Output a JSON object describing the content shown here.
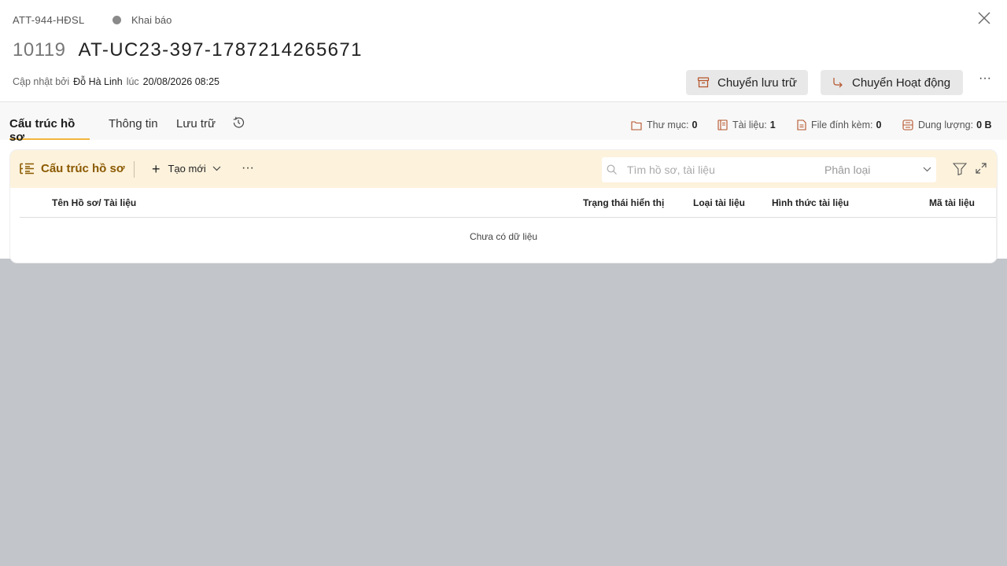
{
  "header": {
    "code": "ATT-944-HĐSL",
    "status": "Khai báo",
    "title_id": "10119",
    "title_name": "AT-UC23-397-1787214265671",
    "updated_prefix": "Cập nhật bởi",
    "updated_by": "Đỗ Hà Linh",
    "updated_at_word": "lúc",
    "updated_time": "20/08/2026 08:25",
    "btn_archive": "Chuyển lưu trữ",
    "btn_move": "Chuyển Hoạt động",
    "more": "···"
  },
  "tabs": [
    {
      "label": "Cấu trúc hồ sơ"
    },
    {
      "label": "Thông tin"
    },
    {
      "label": "Lưu trữ"
    }
  ],
  "stats": {
    "folders_label": "Thư mục:",
    "folders_value": "0",
    "docs_label": "Tài liệu:",
    "docs_value": "1",
    "files_label": "File đính kèm:",
    "files_value": "0",
    "size_label": "Dung lượng:",
    "size_value": "0 B"
  },
  "toolbar": {
    "title": "Cấu trúc hồ sơ",
    "new_label": "Tạo mới",
    "more": "···",
    "search_placeholder": "Tìm hồ sơ, tài liệu",
    "classify_placeholder": "Phân loại"
  },
  "table": {
    "columns": [
      "Tên Hồ sơ/ Tài liệu",
      "Trạng thái hiển thị",
      "Loại tài liệu",
      "Hình thức tài liệu",
      "Mã tài liệu"
    ],
    "empty": "Chưa có dữ liệu"
  },
  "colors": {
    "accent": "#f2b53d",
    "toolbar_bg": "#fdf2dc",
    "toolbar_title": "#8a5a00",
    "overlay": "#c2c5ca"
  }
}
